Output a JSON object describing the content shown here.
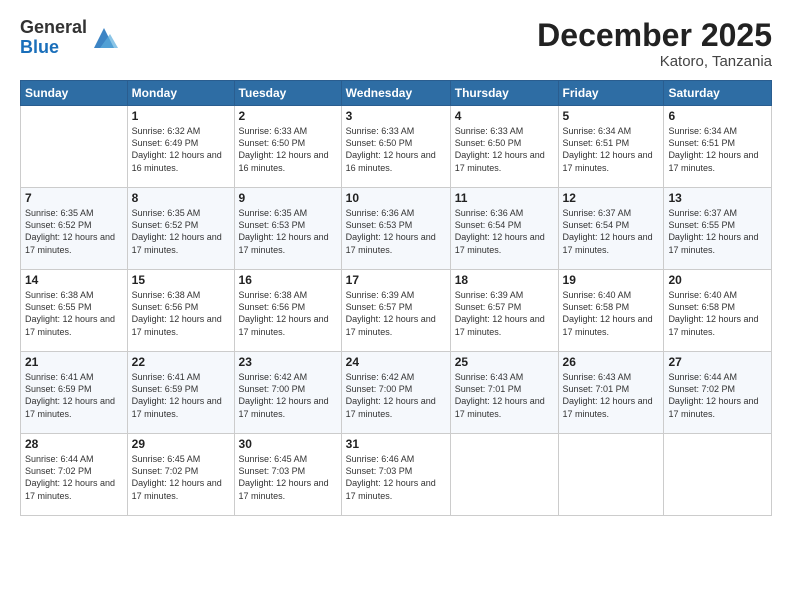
{
  "logo": {
    "general": "General",
    "blue": "Blue"
  },
  "header": {
    "month": "December 2025",
    "location": "Katoro, Tanzania"
  },
  "days_of_week": [
    "Sunday",
    "Monday",
    "Tuesday",
    "Wednesday",
    "Thursday",
    "Friday",
    "Saturday"
  ],
  "weeks": [
    [
      {
        "day": "",
        "sunrise": "",
        "sunset": "",
        "daylight": ""
      },
      {
        "day": "1",
        "sunrise": "Sunrise: 6:32 AM",
        "sunset": "Sunset: 6:49 PM",
        "daylight": "Daylight: 12 hours and 16 minutes."
      },
      {
        "day": "2",
        "sunrise": "Sunrise: 6:33 AM",
        "sunset": "Sunset: 6:50 PM",
        "daylight": "Daylight: 12 hours and 16 minutes."
      },
      {
        "day": "3",
        "sunrise": "Sunrise: 6:33 AM",
        "sunset": "Sunset: 6:50 PM",
        "daylight": "Daylight: 12 hours and 16 minutes."
      },
      {
        "day": "4",
        "sunrise": "Sunrise: 6:33 AM",
        "sunset": "Sunset: 6:50 PM",
        "daylight": "Daylight: 12 hours and 17 minutes."
      },
      {
        "day": "5",
        "sunrise": "Sunrise: 6:34 AM",
        "sunset": "Sunset: 6:51 PM",
        "daylight": "Daylight: 12 hours and 17 minutes."
      },
      {
        "day": "6",
        "sunrise": "Sunrise: 6:34 AM",
        "sunset": "Sunset: 6:51 PM",
        "daylight": "Daylight: 12 hours and 17 minutes."
      }
    ],
    [
      {
        "day": "7",
        "sunrise": "Sunrise: 6:35 AM",
        "sunset": "Sunset: 6:52 PM",
        "daylight": "Daylight: 12 hours and 17 minutes."
      },
      {
        "day": "8",
        "sunrise": "Sunrise: 6:35 AM",
        "sunset": "Sunset: 6:52 PM",
        "daylight": "Daylight: 12 hours and 17 minutes."
      },
      {
        "day": "9",
        "sunrise": "Sunrise: 6:35 AM",
        "sunset": "Sunset: 6:53 PM",
        "daylight": "Daylight: 12 hours and 17 minutes."
      },
      {
        "day": "10",
        "sunrise": "Sunrise: 6:36 AM",
        "sunset": "Sunset: 6:53 PM",
        "daylight": "Daylight: 12 hours and 17 minutes."
      },
      {
        "day": "11",
        "sunrise": "Sunrise: 6:36 AM",
        "sunset": "Sunset: 6:54 PM",
        "daylight": "Daylight: 12 hours and 17 minutes."
      },
      {
        "day": "12",
        "sunrise": "Sunrise: 6:37 AM",
        "sunset": "Sunset: 6:54 PM",
        "daylight": "Daylight: 12 hours and 17 minutes."
      },
      {
        "day": "13",
        "sunrise": "Sunrise: 6:37 AM",
        "sunset": "Sunset: 6:55 PM",
        "daylight": "Daylight: 12 hours and 17 minutes."
      }
    ],
    [
      {
        "day": "14",
        "sunrise": "Sunrise: 6:38 AM",
        "sunset": "Sunset: 6:55 PM",
        "daylight": "Daylight: 12 hours and 17 minutes."
      },
      {
        "day": "15",
        "sunrise": "Sunrise: 6:38 AM",
        "sunset": "Sunset: 6:56 PM",
        "daylight": "Daylight: 12 hours and 17 minutes."
      },
      {
        "day": "16",
        "sunrise": "Sunrise: 6:38 AM",
        "sunset": "Sunset: 6:56 PM",
        "daylight": "Daylight: 12 hours and 17 minutes."
      },
      {
        "day": "17",
        "sunrise": "Sunrise: 6:39 AM",
        "sunset": "Sunset: 6:57 PM",
        "daylight": "Daylight: 12 hours and 17 minutes."
      },
      {
        "day": "18",
        "sunrise": "Sunrise: 6:39 AM",
        "sunset": "Sunset: 6:57 PM",
        "daylight": "Daylight: 12 hours and 17 minutes."
      },
      {
        "day": "19",
        "sunrise": "Sunrise: 6:40 AM",
        "sunset": "Sunset: 6:58 PM",
        "daylight": "Daylight: 12 hours and 17 minutes."
      },
      {
        "day": "20",
        "sunrise": "Sunrise: 6:40 AM",
        "sunset": "Sunset: 6:58 PM",
        "daylight": "Daylight: 12 hours and 17 minutes."
      }
    ],
    [
      {
        "day": "21",
        "sunrise": "Sunrise: 6:41 AM",
        "sunset": "Sunset: 6:59 PM",
        "daylight": "Daylight: 12 hours and 17 minutes."
      },
      {
        "day": "22",
        "sunrise": "Sunrise: 6:41 AM",
        "sunset": "Sunset: 6:59 PM",
        "daylight": "Daylight: 12 hours and 17 minutes."
      },
      {
        "day": "23",
        "sunrise": "Sunrise: 6:42 AM",
        "sunset": "Sunset: 7:00 PM",
        "daylight": "Daylight: 12 hours and 17 minutes."
      },
      {
        "day": "24",
        "sunrise": "Sunrise: 6:42 AM",
        "sunset": "Sunset: 7:00 PM",
        "daylight": "Daylight: 12 hours and 17 minutes."
      },
      {
        "day": "25",
        "sunrise": "Sunrise: 6:43 AM",
        "sunset": "Sunset: 7:01 PM",
        "daylight": "Daylight: 12 hours and 17 minutes."
      },
      {
        "day": "26",
        "sunrise": "Sunrise: 6:43 AM",
        "sunset": "Sunset: 7:01 PM",
        "daylight": "Daylight: 12 hours and 17 minutes."
      },
      {
        "day": "27",
        "sunrise": "Sunrise: 6:44 AM",
        "sunset": "Sunset: 7:02 PM",
        "daylight": "Daylight: 12 hours and 17 minutes."
      }
    ],
    [
      {
        "day": "28",
        "sunrise": "Sunrise: 6:44 AM",
        "sunset": "Sunset: 7:02 PM",
        "daylight": "Daylight: 12 hours and 17 minutes."
      },
      {
        "day": "29",
        "sunrise": "Sunrise: 6:45 AM",
        "sunset": "Sunset: 7:02 PM",
        "daylight": "Daylight: 12 hours and 17 minutes."
      },
      {
        "day": "30",
        "sunrise": "Sunrise: 6:45 AM",
        "sunset": "Sunset: 7:03 PM",
        "daylight": "Daylight: 12 hours and 17 minutes."
      },
      {
        "day": "31",
        "sunrise": "Sunrise: 6:46 AM",
        "sunset": "Sunset: 7:03 PM",
        "daylight": "Daylight: 12 hours and 17 minutes."
      },
      {
        "day": "",
        "sunrise": "",
        "sunset": "",
        "daylight": ""
      },
      {
        "day": "",
        "sunrise": "",
        "sunset": "",
        "daylight": ""
      },
      {
        "day": "",
        "sunrise": "",
        "sunset": "",
        "daylight": ""
      }
    ]
  ]
}
